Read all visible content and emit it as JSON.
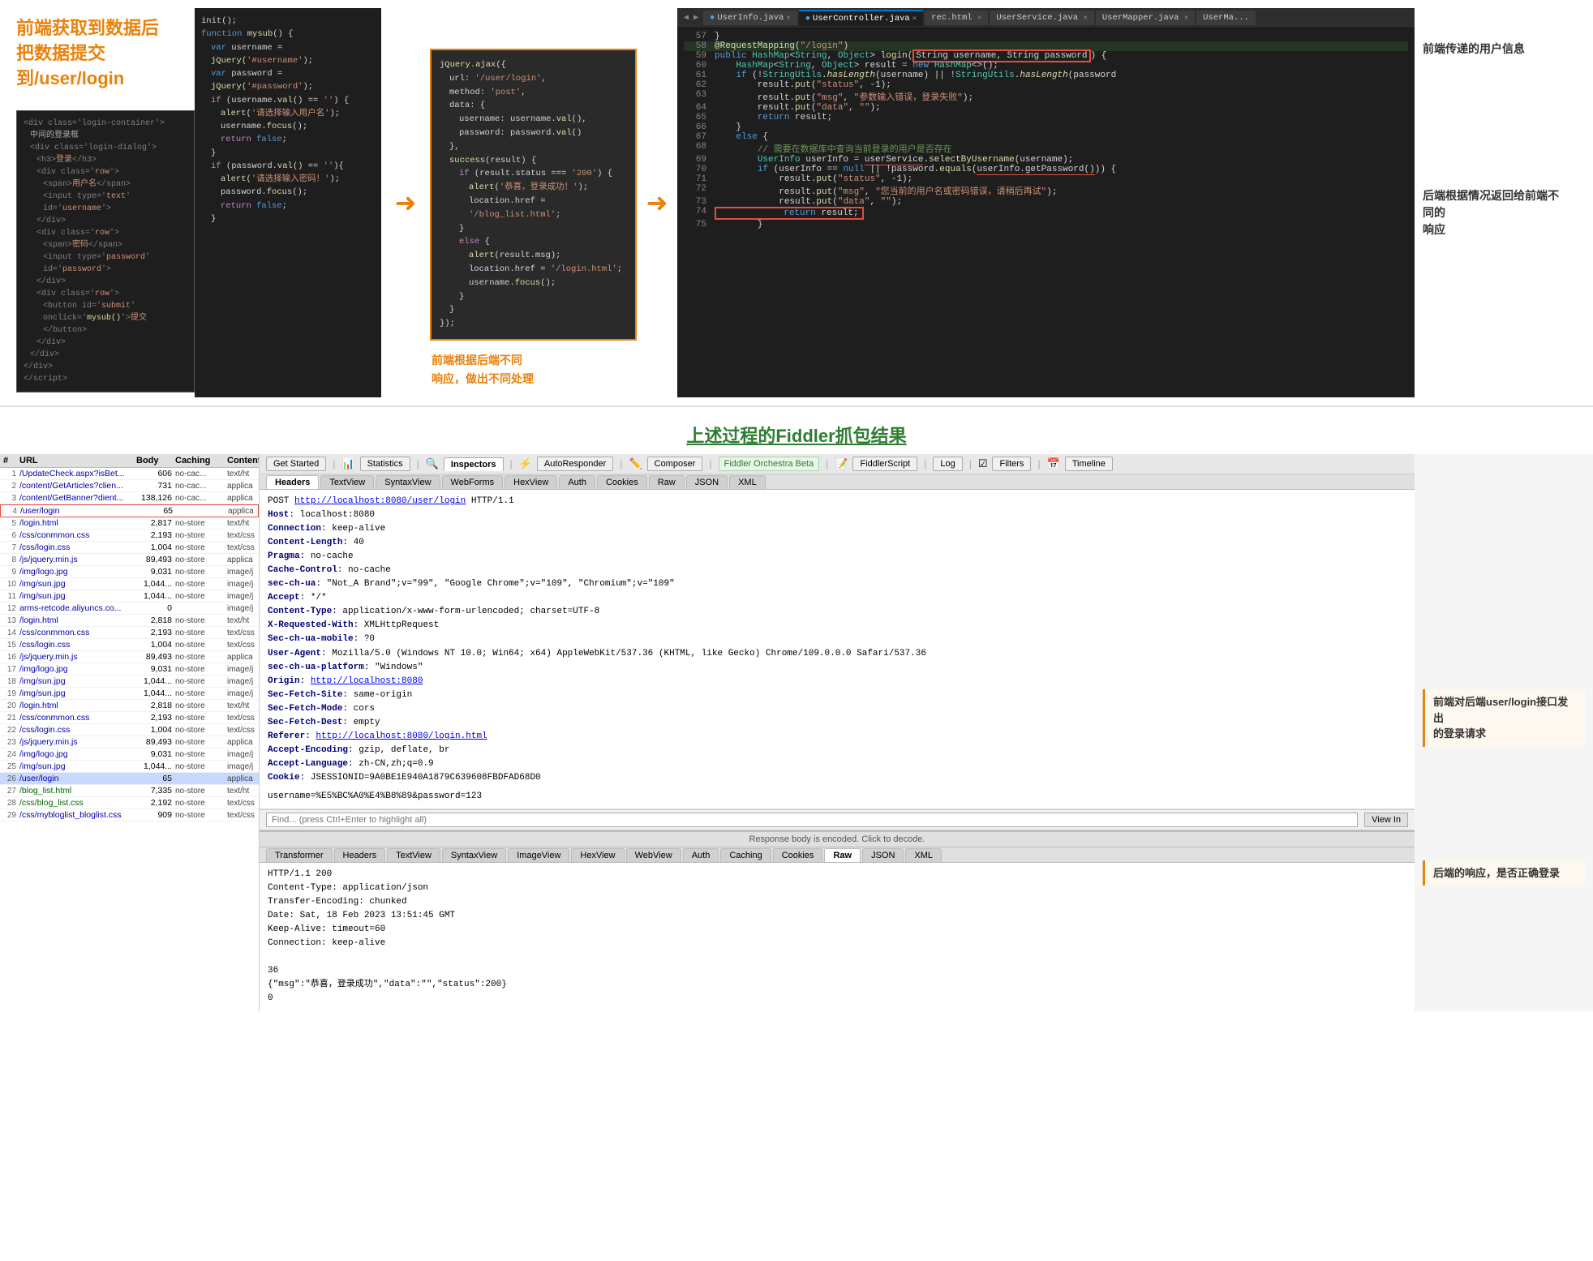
{
  "top": {
    "left_annotation": {
      "line1": "前端获取到数据后",
      "line2": "把数据提交",
      "line3": "到/user/login"
    },
    "bottom_annotation": {
      "text": "前端根据后端不同\n响应，做出不同处理"
    },
    "right_annotations": {
      "ann1_title": "前端传递的用户信息",
      "ann2_title": "后端根据情况返回给前端不同的",
      "ann2_title2": "响应"
    }
  },
  "section_title": "上述过程的Fiddler抓包结果",
  "fiddler": {
    "toolbar": {
      "get_started": "Get Started",
      "statistics": "Statistics",
      "inspectors": "Inspectors",
      "auto_responder": "AutoResponder",
      "composer": "Composer",
      "fo_beta": "Fiddler Orchestra Beta",
      "fiddler_script": "FiddlerScript",
      "log": "Log",
      "filters": "Filters",
      "timeline": "Timeline"
    },
    "sub_tabs": [
      "Headers",
      "TextView",
      "SyntaxView",
      "WebForms",
      "HexView",
      "Auth",
      "Cookies",
      "Raw",
      "JSON",
      "XML"
    ],
    "list_headers": [
      "#",
      "URL",
      "Body",
      "Caching",
      "Content-T..."
    ],
    "list_rows": [
      {
        "num": "",
        "url": "/UpdateCheck.aspx?isBet...",
        "body": "606",
        "caching": "no-cac...",
        "content": "text/ht"
      },
      {
        "num": "",
        "url": "/content/GetArticles?clien...",
        "body": "731",
        "caching": "no-cac...",
        "content": "applica"
      },
      {
        "num": "",
        "url": "/content/GetBanner?dient...",
        "body": "138,126",
        "caching": "no-cac...",
        "content": "applica"
      },
      {
        "num": "",
        "url": "/user/login",
        "body": "65",
        "caching": "",
        "content": "applica"
      },
      {
        "num": "",
        "url": "/login.html",
        "body": "2,817",
        "caching": "no-store",
        "content": "text/ht"
      },
      {
        "num": "",
        "url": "/css/conmmon.css",
        "body": "2,193",
        "caching": "no-store",
        "content": "text/css"
      },
      {
        "num": "",
        "url": "/css/login.css",
        "body": "1,004",
        "caching": "no-store",
        "content": "text/css"
      },
      {
        "num": "",
        "url": "/js/jquery.min.js",
        "body": "89,493",
        "caching": "no-store",
        "content": "applica"
      },
      {
        "num": "",
        "url": "/img/logo.jpg",
        "body": "9,031",
        "caching": "no-store",
        "content": "image/j"
      },
      {
        "num": "",
        "url": "/img/sun.jpg",
        "body": "1,044...",
        "caching": "no-store",
        "content": "image/j"
      },
      {
        "num": "",
        "url": "/img/sun.jpg",
        "body": "1,044...",
        "caching": "no-store",
        "content": "image/j"
      },
      {
        "num": "",
        "url": "arms-retcode.aliyuncs.co...",
        "body": "0",
        "caching": "",
        "content": "image/j"
      },
      {
        "num": "",
        "url": "/login.html",
        "body": "2,818",
        "caching": "no-store",
        "content": "text/ht"
      },
      {
        "num": "",
        "url": "/css/conmmon.css",
        "body": "2,193",
        "caching": "no-store",
        "content": "text/css"
      },
      {
        "num": "",
        "url": "/css/login.css",
        "body": "1,004",
        "caching": "no-store",
        "content": "text/css"
      },
      {
        "num": "",
        "url": "/js/jquery.min.js",
        "body": "89,493",
        "caching": "no-store",
        "content": "applica"
      },
      {
        "num": "",
        "url": "/img/logo.jpg",
        "body": "9,031",
        "caching": "no-store",
        "content": "image/j"
      },
      {
        "num": "",
        "url": "/img/sun.jpg",
        "body": "1,044...",
        "caching": "no-store",
        "content": "image/j"
      },
      {
        "num": "",
        "url": "/img/sun.jpg",
        "body": "1,044...",
        "caching": "no-store",
        "content": "image/j"
      },
      {
        "num": "",
        "url": "/login.html",
        "body": "2,818",
        "caching": "no-store",
        "content": "text/ht"
      },
      {
        "num": "",
        "url": "/css/conmmon.css",
        "body": "2,193",
        "caching": "no-store",
        "content": "text/css"
      },
      {
        "num": "",
        "url": "/css/login.css",
        "body": "1,004",
        "caching": "no-store",
        "content": "text/css"
      },
      {
        "num": "",
        "url": "/js/jquery.min.js",
        "body": "89,493",
        "caching": "no-store",
        "content": "applica"
      },
      {
        "num": "",
        "url": "/img/logo.jpg",
        "body": "9,031",
        "caching": "no-store",
        "content": "image/j"
      },
      {
        "num": "",
        "url": "/img/sun.jpg",
        "body": "1,044...",
        "caching": "no-store",
        "content": "image/j"
      },
      {
        "num": "",
        "url": "/user/login",
        "body": "65",
        "caching": "",
        "content": "applica",
        "selected": true
      },
      {
        "num": "",
        "url": "/blog_list.html",
        "body": "7,335",
        "caching": "no-store",
        "content": "text/ht"
      },
      {
        "num": "",
        "url": "/css/blog_list.css",
        "body": "2,192",
        "caching": "no-store",
        "content": "text/css"
      },
      {
        "num": "",
        "url": "/css/mybloglist_bloglist.css",
        "body": "909",
        "caching": "no-store",
        "content": "text/css"
      }
    ],
    "request": {
      "first_line": "POST http://localhost:8080/user/login HTTP/1.1",
      "headers": [
        [
          "Host",
          "localhost:8080"
        ],
        [
          "Connection",
          "keep-alive"
        ],
        [
          "Content-Length",
          "40"
        ],
        [
          "Pragma",
          "no-cache"
        ],
        [
          "Cache-Control",
          "no-cache"
        ],
        [
          "sec-ch-ua",
          "\"Not_A Brand\";v=\"99\", \"Google Chrome\";v=\"109\", \"Chromium\";v=\"109\""
        ],
        [
          "Accept",
          "*/*"
        ],
        [
          "Content-Type",
          "application/x-www-form-urlencoded; charset=UTF-8"
        ],
        [
          "X-Requested-With",
          "XMLHttpRequest"
        ],
        [
          "sec-ch-ua-mobile",
          "?0"
        ],
        [
          "User-Agent",
          "Mozilla/5.0 (Windows NT 10.0; Win64; x64) AppleWebKit/537.36 (KHTML, like Gecko) Chrome/109.0.0.0 Safari/537.36"
        ],
        [
          "sec-ch-ua-platform",
          "\"Windows\""
        ],
        [
          "Origin",
          "http://localhost:8080"
        ],
        [
          "Sec-Fetch-Site",
          "same-origin"
        ],
        [
          "Sec-Fetch-Mode",
          "cors"
        ],
        [
          "Sec-Fetch-Dest",
          "empty"
        ],
        [
          "Referer",
          "http://localhost:8080/login.html"
        ],
        [
          "Accept-Encoding",
          "gzip, deflate, br"
        ],
        [
          "Accept-Language",
          "zh-CN,zh;q=0.9"
        ],
        [
          "Cookie",
          "JSESSIONID=9A0BE1E940A1879C639608FBDFAD68D0"
        ]
      ],
      "body": "username=%E5%BC%A0%E4%B8%89&password=123"
    },
    "search_placeholder": "Find... (press Ctrl+Enter to highlight all)",
    "view_in_btn": "View In",
    "response_header_msg": "Response body is encoded. Click to decode.",
    "response_sub_tabs": [
      "Transformer",
      "Headers",
      "TextView",
      "SyntaxView",
      "ImageView",
      "HexView",
      "WebView",
      "Auth",
      "Caching",
      "Cookies",
      "Raw",
      "JSON",
      "XML"
    ],
    "response_content_lines": [
      "HTTP/1.1 200",
      "Content-Type: application/json",
      "Transfer-Encoding: chunked",
      "Date: Sat, 18 Feb 2023 13:51:45 GMT",
      "Keep-Alive: timeout=60",
      "Connection: keep-alive",
      "",
      "36",
      "{\"msg\":\"恭喜，登录成功\",\"data\":\"\",\"status\":200}",
      "0"
    ],
    "annotations": {
      "request_ann": "前端对后端user/login接口发出\n的登录请求",
      "response_ann": "后端的响应，是否正确登录"
    }
  },
  "code_left": {
    "lines": [
      "init();",
      "function mysub() {",
      "  var username = jQuery('#username');",
      "  var password = jQuery('#password');",
      "  if (username.val() == '') {",
      "    alert('请选择输入用户名');",
      "    username.focus();",
      "    return false;",
      "  }",
      "  if (password.val() == '') {",
      "    alert('请选择输入密码！');",
      "    password.focus();",
      "    return false;",
      "  }"
    ]
  },
  "code_right_tabs": [
    "UserInfo.java",
    "UserController.java",
    "rec.html",
    "UserService.java",
    "UserMapper.java",
    "UserMa..."
  ],
  "code_right_lines": [
    {
      "num": "57",
      "code": "}"
    },
    {
      "num": "58",
      "code": "@RequestMapping(\"/login\")"
    },
    {
      "num": "59",
      "code": "public HashMap<String, Object> login(String username, String password) {"
    },
    {
      "num": "60",
      "code": "    HashMap<String, Object> result = new HashMap<>();"
    },
    {
      "num": "61",
      "code": "    if (!StringUtils.hasLength(username) || !StringUtils.hasLength(password"
    },
    {
      "num": "62",
      "code": "        result.put(\"status\", -1);"
    },
    {
      "num": "63",
      "code": "        result.put(\"msg\", \"参数输入错误，登录失败\");"
    },
    {
      "num": "64",
      "code": "        result.put(\"data\", \"\");"
    },
    {
      "num": "65",
      "code": "        return result;"
    },
    {
      "num": "66",
      "code": "    }"
    },
    {
      "num": "67",
      "code": "    else {"
    },
    {
      "num": "68",
      "code": "        // 需要在数据库中查询当前登录的用户是否存在"
    },
    {
      "num": "69",
      "code": "        UserInfo userInfo = userService.selectByUsername(username);"
    },
    {
      "num": "70",
      "code": "        if (userInfo == null || !password.equals(userInfo.getPassword())) {"
    },
    {
      "num": "71",
      "code": "            result.put(\"status\", -1);"
    },
    {
      "num": "72",
      "code": "            result.put(\"msg\", \"您当前的用户名或密码错误，请稍后再试\");"
    },
    {
      "num": "73",
      "code": "            result.put(\"data\", \"\");"
    },
    {
      "num": "74",
      "code": "            return result;"
    },
    {
      "num": "75",
      "code": "        }"
    }
  ],
  "jquery_ajax_code": [
    "jQuery.ajax({",
    "  url: '/user/login',",
    "  method: 'post',",
    "  data: {",
    "    username: username.val(),",
    "    password: password.val()",
    "  },",
    "  success(result) {",
    "    if (result.status === '200') {",
    "      alert('恭喜，登录成功！');",
    "      location.href = '/blog_list.html';",
    "    }",
    "    else {",
    "      alert(result.msg);",
    "      location.href = '/login.html';",
    "      username.focus();",
    "    }",
    "  }",
    "});"
  ],
  "html_code_lines": [
    "<div class='login-container'>",
    "  中间的登录框",
    "  <div class='login-dialog'>",
    "    <h3>登录</h3>",
    "    <div class='row'>",
    "      <span>用户名</span>",
    "      <input type='text' id='username'>",
    "    </div>",
    "    <div class='row'>",
    "      <span>密码</span>",
    "      <input type='password' id='password'>",
    "    </div>",
    "    <div class='row'>",
    "      <button id='submit' onclick='mysub()'>提交</button>",
    "    </div>",
    "  </div>",
    "</div>"
  ]
}
